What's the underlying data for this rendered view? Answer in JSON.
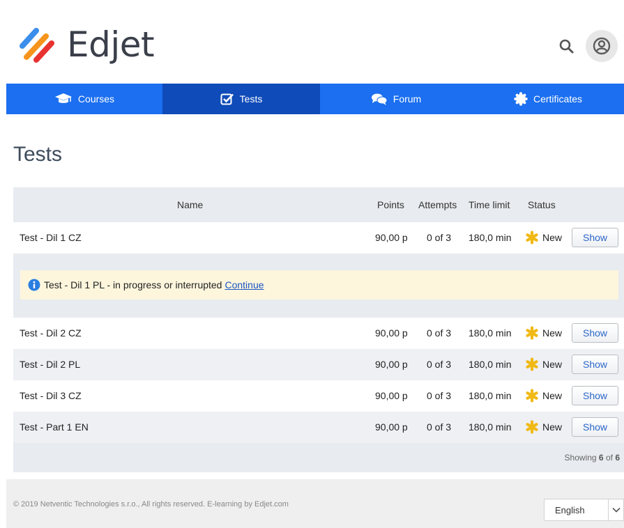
{
  "brand": {
    "name": "Edjet",
    "accent": "#1b6ff0",
    "accent_dark": "#0f4bb9"
  },
  "header": {
    "search_icon": "search-icon",
    "avatar_icon": "user-circle-icon"
  },
  "nav": {
    "items": [
      {
        "label": "Courses",
        "icon": "graduation-cap-icon"
      },
      {
        "label": "Tests",
        "icon": "check-square-icon"
      },
      {
        "label": "Forum",
        "icon": "comments-icon"
      },
      {
        "label": "Certificates",
        "icon": "certificate-icon"
      }
    ],
    "active_index": 1
  },
  "page": {
    "title": "Tests"
  },
  "table": {
    "columns": {
      "name": "Name",
      "points": "Points",
      "attempts": "Attempts",
      "time_limit": "Time limit",
      "status": "Status"
    },
    "rows": [
      {
        "name": "Test - Dil 1 CZ",
        "points": "90,00 p",
        "attempts": "0 of 3",
        "time_limit": "180,0 min",
        "status": "New",
        "action": "Show"
      },
      {
        "name": "Test - Dil 2 CZ",
        "points": "90,00 p",
        "attempts": "0 of 3",
        "time_limit": "180,0 min",
        "status": "New",
        "action": "Show"
      },
      {
        "name": "Test - Dil 2 PL",
        "points": "90,00 p",
        "attempts": "0 of 3",
        "time_limit": "180,0 min",
        "status": "New",
        "action": "Show"
      },
      {
        "name": "Test - Dil 3 CZ",
        "points": "90,00 p",
        "attempts": "0 of 3",
        "time_limit": "180,0 min",
        "status": "New",
        "action": "Show"
      },
      {
        "name": "Test - Part 1 EN",
        "points": "90,00 p",
        "attempts": "0 of 3",
        "time_limit": "180,0 min",
        "status": "New",
        "action": "Show"
      }
    ],
    "notice": {
      "text": "Test - Dil 1 PL - in progress or interrupted",
      "link": "Continue",
      "icon": "info-icon"
    },
    "status_icon": "asterisk-star-icon",
    "status_color": "#f0b915",
    "showing": {
      "prefix": "Showing",
      "shown": "6",
      "of": "of",
      "total": "6"
    }
  },
  "footer": {
    "copyright": "© 2019 Netventic Technologies s.r.o., All rights reserved. E-learning by Edjet.com",
    "language": "English"
  }
}
